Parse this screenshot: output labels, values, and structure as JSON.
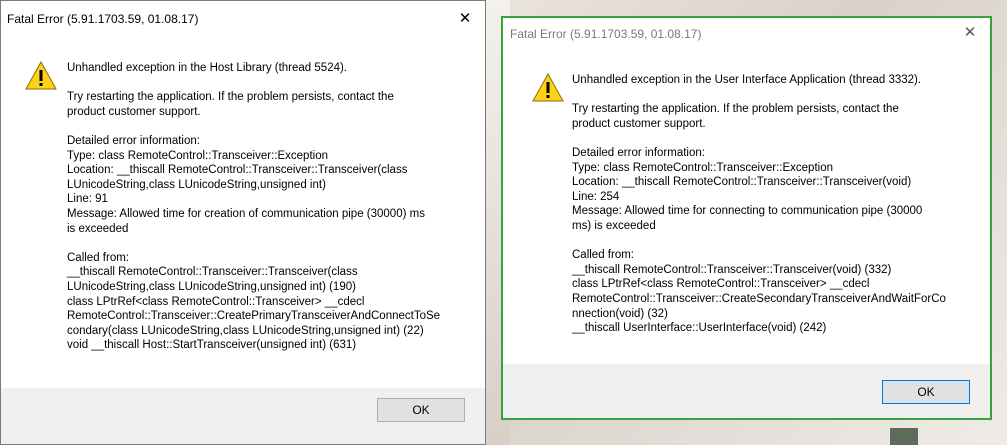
{
  "left_dialog": {
    "title": "Fatal Error (5.91.1703.59, 01.08.17)",
    "close_glyph": "✕",
    "headline": "Unhandled exception in the Host Library (thread 5524).",
    "advice_lines": [
      "Try restarting the application. If the problem persists, contact the",
      "product customer support."
    ],
    "details_lines": [
      "Detailed error information:",
      "Type: class RemoteControl::Transceiver::Exception",
      "Location: __thiscall RemoteControl::Transceiver::Transceiver(class",
      "LUnicodeString,class LUnicodeString,unsigned int)",
      "Line: 91",
      "Message: Allowed time for creation of communication pipe (30000) ms",
      "is exceeded"
    ],
    "called_lines": [
      "Called from:",
      "__thiscall RemoteControl::Transceiver::Transceiver(class",
      "LUnicodeString,class LUnicodeString,unsigned int) (190)",
      "class LPtrRef<class RemoteControl::Transceiver> __cdecl",
      "RemoteControl::Transceiver::CreatePrimaryTransceiverAndConnectToSe",
      "condary(class LUnicodeString,class LUnicodeString,unsigned int) (22)",
      "void __thiscall Host::StartTransceiver(unsigned int) (631)"
    ],
    "ok_label": "OK"
  },
  "right_dialog": {
    "title": "Fatal Error (5.91.1703.59, 01.08.17)",
    "close_glyph": "✕",
    "headline": "Unhandled exception in the User Interface Application (thread 3332).",
    "advice_lines": [
      "Try restarting the application. If the problem persists, contact the",
      "product customer support."
    ],
    "details_lines": [
      "Detailed error information:",
      "Type: class RemoteControl::Transceiver::Exception",
      "Location: __thiscall RemoteControl::Transceiver::Transceiver(void)",
      "Line: 254",
      "Message: Allowed time for connecting to communication pipe (30000",
      "ms) is exceeded"
    ],
    "called_lines": [
      "Called from:",
      "__thiscall RemoteControl::Transceiver::Transceiver(void) (332)",
      "class LPtrRef<class RemoteControl::Transceiver> __cdecl",
      "RemoteControl::Transceiver::CreateSecondaryTransceiverAndWaitForCo",
      "nnection(void) (32)",
      "__thiscall UserInterface::UserInterface(void) (242)"
    ],
    "ok_label": "OK"
  },
  "icons": {
    "warning": "warning-icon",
    "close": "close-icon"
  },
  "colors": {
    "focus_border": "#3aa23c",
    "warning_fill": "#fcd116",
    "button_focus": "#0078d7"
  }
}
